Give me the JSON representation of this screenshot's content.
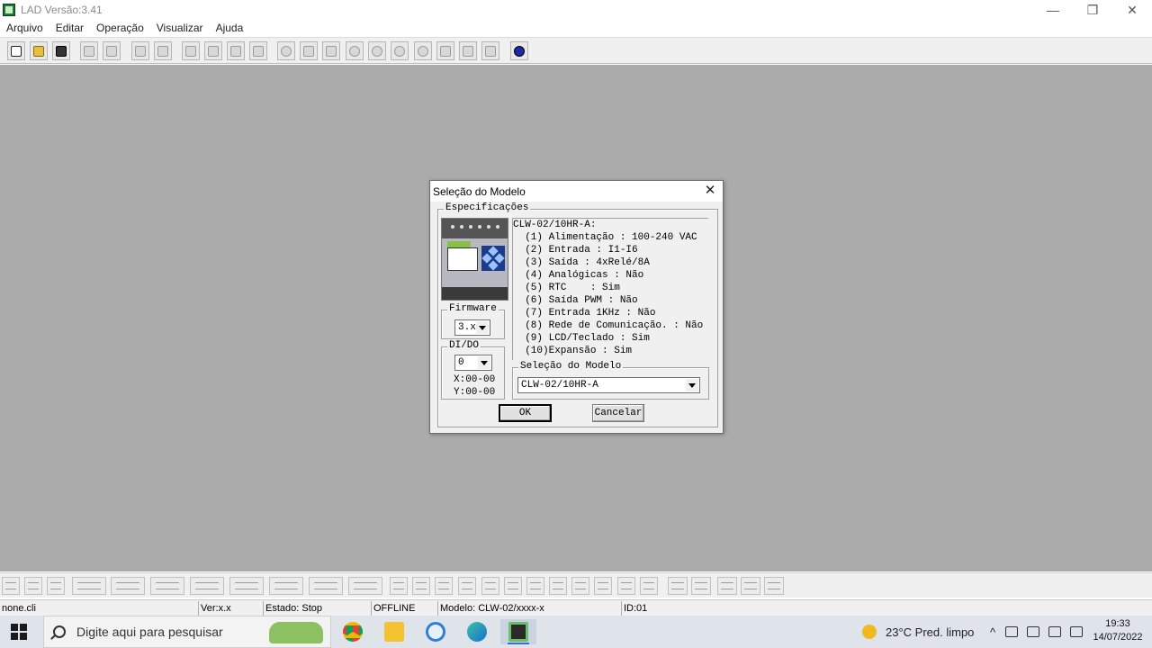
{
  "window": {
    "title": "LAD Versão:3.41",
    "minimize": "—",
    "maximize": "❐",
    "close": "✕"
  },
  "menu": [
    "Arquivo",
    "Editar",
    "Operação",
    "Visualizar",
    "Ajuda"
  ],
  "dialog": {
    "title": "Seleção do Modelo",
    "close": "✕",
    "spec_group_label": "Especificações",
    "firmware_label": "Firmware",
    "firmware_value": "3.x",
    "dido_label": "DI/DO",
    "dido_value": "0",
    "x_range": "X:00-00",
    "y_range": "Y:00-00",
    "spec_lines": [
      "CLW-02/10HR-A:",
      "  (1) Alimentação : 100-240 VAC",
      "  (2) Entrada : I1-I6",
      "  (3) Saída : 4xRelé/8A",
      "  (4) Analógicas : Não",
      "  (5) RTC    : Sim",
      "  (6) Saída PWM : Não",
      "  (7) Entrada 1KHz : Não",
      "  (8) Rede de Comunicação. : Não",
      "  (9) LCD/Teclado : Sim",
      "  (10)Expansão : Sim"
    ],
    "model_group_label": "Seleção do Modelo",
    "model_value": "CLW-02/10HR-A",
    "ok_label": "OK",
    "cancel_label": "Cancelar"
  },
  "status": {
    "file": "none.cli",
    "version": "Ver:x.x",
    "state": "Estado: Stop",
    "connection": "OFFLINE",
    "model": "Modelo: CLW-02/xxxx-x",
    "id": "ID:01"
  },
  "taskbar": {
    "search_placeholder": "Digite aqui para pesquisar",
    "weather": "23°C  Pred. limpo",
    "time": "19:33",
    "date": "14/07/2022"
  }
}
